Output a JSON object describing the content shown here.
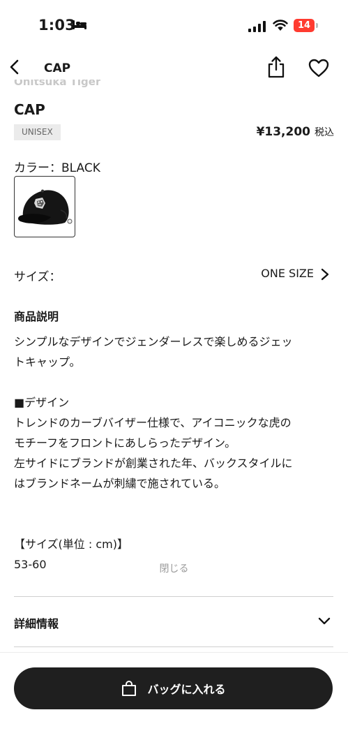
{
  "status_bar": {
    "time": "1:03",
    "battery": "14"
  },
  "nav": {
    "title": "CAP"
  },
  "product": {
    "brand": "Onitsuka Tiger",
    "name": "CAP",
    "tag": "UNISEX",
    "price": "¥13,200",
    "tax_label": "税込"
  },
  "color": {
    "label": "カラー：BLACK"
  },
  "size": {
    "label": "サイズ：",
    "value": "ONE SIZE"
  },
  "description": {
    "title": "商品説明",
    "body": "シンプルなデザインでジェンダーレスで楽しめるジェッ\nトキャップ。\n\n■デザイン\nトレンドのカーブバイザー仕様で、アイコニックな虎の\nモチーフをフロントにあしらったデザイン。\n左サイドにブランドが創業された年、バックスタイルに\nはブランドネームが刺繍で施されている。\n\n\n【サイズ(単位 : cm)】\n53-60",
    "close_label": "閉じる"
  },
  "details": {
    "label": "詳細情報"
  },
  "cta": {
    "label": "バッグに入れる"
  }
}
